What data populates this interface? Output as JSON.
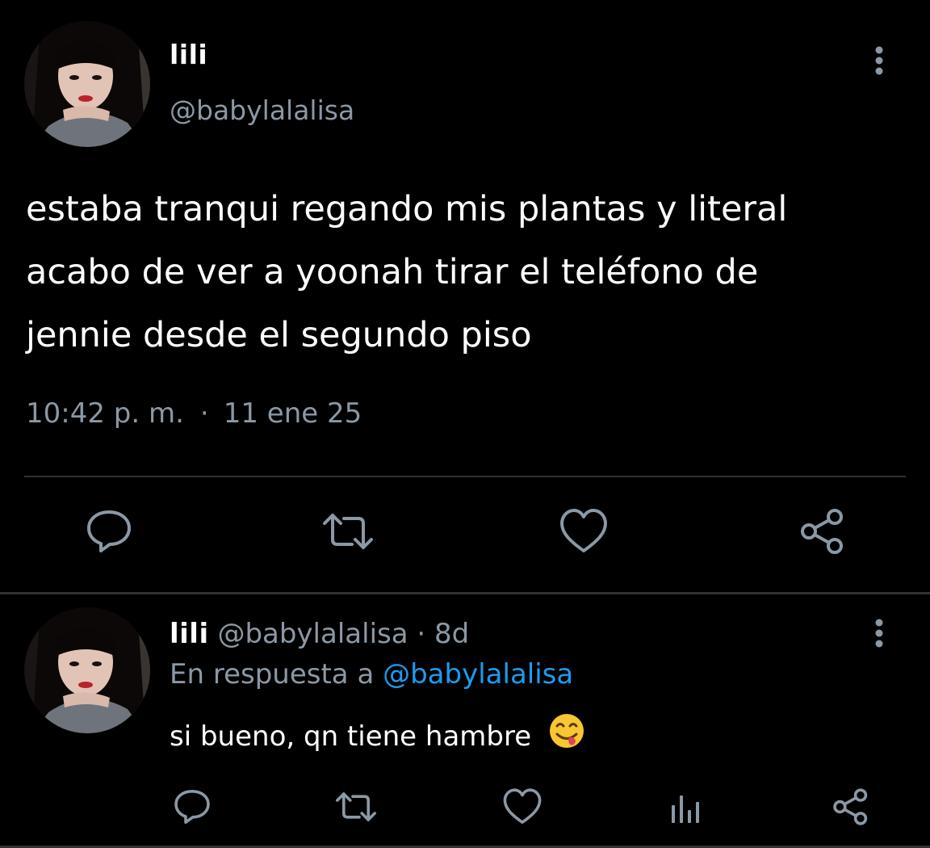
{
  "colors": {
    "background": "#000000",
    "text_primary": "#ffffff",
    "text_secondary": "#8b98a5",
    "link": "#1d9bf0",
    "divider": "#2f3336"
  },
  "main_tweet": {
    "display_name": "lili",
    "handle": "@babylalalisa",
    "text_lines": [
      "estaba tranqui regando mis plantas y literal",
      "acabo de ver a yoonah tirar el teléfono de",
      "jennie desde el segundo piso"
    ],
    "time": "10:42 p. m.",
    "separator": "·",
    "date": "11 ene 25",
    "actions": [
      "reply-icon",
      "retweet-icon",
      "heart-icon",
      "share-icon"
    ]
  },
  "reply_tweet": {
    "display_name": "lili",
    "handle": "@babylalalisa",
    "separator": "·",
    "age": "8d",
    "context_prefix": "En respuesta a",
    "context_handle": "@babylalalisa",
    "text": "si bueno, qn tiene hambre",
    "emoji": "face-savoring-food-emoji",
    "actions": [
      "reply-icon",
      "retweet-icon",
      "heart-icon",
      "stats-icon",
      "share-icon"
    ]
  }
}
